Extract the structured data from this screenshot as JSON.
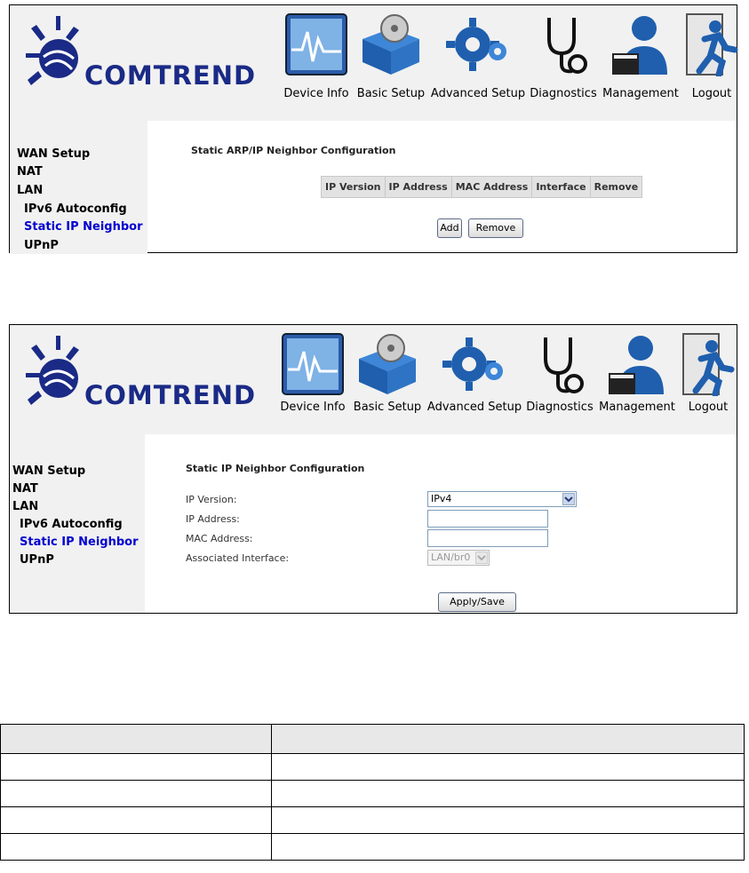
{
  "brand": {
    "logo_text": "COMTREND"
  },
  "nav": [
    {
      "label": "Device Info",
      "icon": "device-info-icon"
    },
    {
      "label": "Basic Setup",
      "icon": "basic-setup-icon"
    },
    {
      "label": "Advanced Setup",
      "icon": "advanced-setup-icon"
    },
    {
      "label": "Diagnostics",
      "icon": "diagnostics-icon"
    },
    {
      "label": "Management",
      "icon": "management-icon"
    },
    {
      "label": "Logout",
      "icon": "logout-icon"
    }
  ],
  "sidebar": {
    "items": [
      {
        "label": "WAN Setup"
      },
      {
        "label": "NAT"
      },
      {
        "label": "LAN"
      },
      {
        "label": "IPv6 Autoconfig"
      },
      {
        "label": "Static IP Neighbor",
        "active": true
      },
      {
        "label": "UPnP"
      }
    ]
  },
  "screen1": {
    "title": "Static ARP/IP Neighbor Configuration",
    "columns": [
      "IP Version",
      "IP Address",
      "MAC Address",
      "Interface",
      "Remove"
    ],
    "add_label": "Add",
    "remove_label": "Remove"
  },
  "screen2": {
    "title": "Static IP Neighbor Configuration",
    "ip_version_label": "IP Version:",
    "ip_version_value": "IPv4",
    "ip_address_label": "IP Address:",
    "mac_address_label": "MAC Address:",
    "interface_label": "Associated Interface:",
    "interface_value": "LAN/br0",
    "apply_label": "Apply/Save"
  },
  "colors": {
    "brand_blue": "#1a2a86",
    "active_link": "#0000d0",
    "header_bg": "#f1f1f1"
  }
}
